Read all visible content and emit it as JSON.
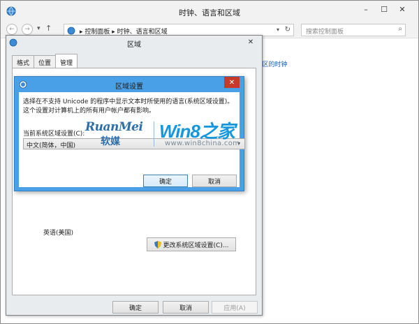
{
  "main_window": {
    "title": "时钟、语言和区域",
    "breadcrumb_root": "控制面板",
    "breadcrumb_current": "时钟、语言和区域",
    "search_placeholder": "搜索控制面板",
    "related_link": "i区的时钟"
  },
  "region_dialog": {
    "title": "区域",
    "tabs": [
      "格式",
      "位置",
      "管理"
    ],
    "active_tab": "管理",
    "current_language": "英语(美国)",
    "change_locale_button": "更改系统区域设置(C)...",
    "ok": "确定",
    "cancel": "取消",
    "apply": "应用(A)"
  },
  "region_settings_dialog": {
    "title": "区域设置",
    "description": "选择在不支持 Unicode 的程序中显示文本时所使用的语言(系统区域设置)。这个设置对计算机上的所有用户帐户都有影响。",
    "current_label": "当前系统区域设置(C):",
    "selected_locale": "中文(简体，中国)",
    "ok": "确定",
    "cancel": "取消"
  },
  "watermark": {
    "ruanmei_en": "RuanMei",
    "ruanmei_cn": "软媒",
    "win8_brand": "Win8之家",
    "url": "www.win8china.com"
  },
  "colors": {
    "dialog_frame": "#4aa0e6",
    "close_button": "#c73a2a",
    "link": "#1a5fb4"
  },
  "icons": {
    "app": "globe-clock-icon",
    "shield": "uac-shield-icon"
  }
}
